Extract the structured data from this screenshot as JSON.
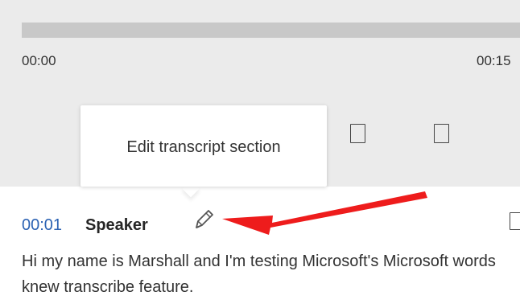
{
  "player": {
    "time_start": "00:00",
    "time_end": "00:15"
  },
  "tooltip": {
    "text": "Edit transcript section"
  },
  "entry": {
    "timestamp": "00:01",
    "speaker": "Speaker",
    "text": "Hi my name is Marshall and I'm testing Microsoft's Microsoft words knew transcribe feature."
  },
  "colors": {
    "timestamp": "#2b62b3",
    "annotation_arrow": "#ee1c1c",
    "panel_background": "#ebebeb",
    "progress_track": "#c8c8c8"
  },
  "icons": {
    "edit": "pencil-icon",
    "annotation": "red-arrow-icon"
  }
}
